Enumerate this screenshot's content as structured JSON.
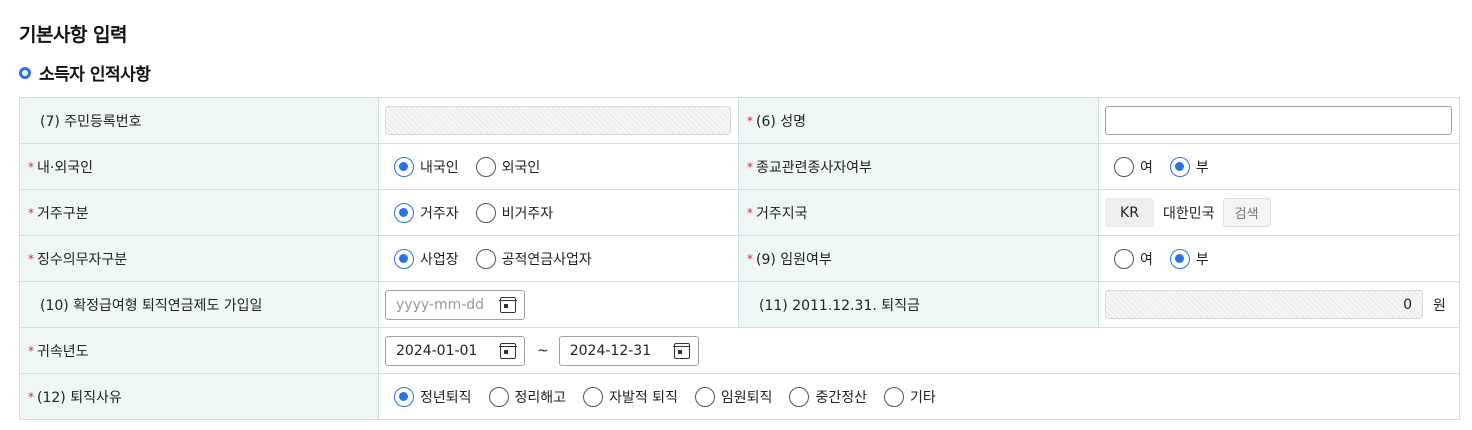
{
  "page_title": "기본사항 입력",
  "section_title": "소득자 인적사항",
  "rows": {
    "resident_no": {
      "label": "(7) 주민등록번호"
    },
    "name": {
      "label": "(6) 성명",
      "value": ""
    },
    "nationality": {
      "label": "내·외국인",
      "options": [
        "내국인",
        "외국인"
      ],
      "selected": "내국인"
    },
    "religious": {
      "label": "종교관련종사자여부",
      "options": [
        "여",
        "부"
      ],
      "selected": "부"
    },
    "residence": {
      "label": "거주구분",
      "options": [
        "거주자",
        "비거주자"
      ],
      "selected": "거주자"
    },
    "residence_country": {
      "label": "거주지국",
      "code": "KR",
      "country_name": "대한민국",
      "search_label": "검색"
    },
    "withholding": {
      "label": "징수의무자구분",
      "options": [
        "사업장",
        "공적연금사업자"
      ],
      "selected": "사업장"
    },
    "executive": {
      "label": "(9) 임원여부",
      "options": [
        "여",
        "부"
      ],
      "selected": "부"
    },
    "db_pension_join": {
      "label": "(10) 확정급여형 퇴직연금제도 가입일",
      "placeholder": "yyyy-mm-dd"
    },
    "severance_2011": {
      "label": "(11) 2011.12.31. 퇴직금",
      "value": "0",
      "unit": "원"
    },
    "attribution_year": {
      "label": "귀속년도",
      "from": "2024-01-01",
      "to": "2024-12-31",
      "separator": "~"
    },
    "reason": {
      "label": "(12) 퇴직사유",
      "options": [
        "정년퇴직",
        "정리해고",
        "자발적 퇴직",
        "임원퇴직",
        "중간정산",
        "기타"
      ],
      "selected": "정년퇴직"
    }
  },
  "required_mark": "*",
  "colors": {
    "accent": "#2b72e8",
    "required": "#e0243a",
    "header_bg": "#eef7f6",
    "border": "#cfdfe0"
  }
}
